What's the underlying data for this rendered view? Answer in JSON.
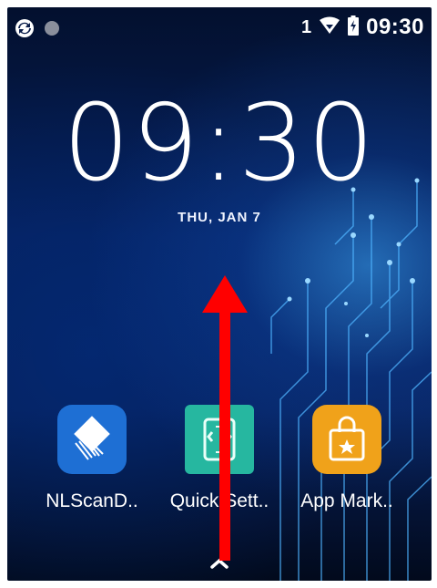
{
  "status_bar": {
    "left_icons": [
      "sync-icon",
      "notification-dot-icon"
    ],
    "sim_number": "1",
    "right_icons": [
      "wifi-icon",
      "battery-icon"
    ],
    "time": "09:30"
  },
  "lockscreen": {
    "clock": "09:30",
    "date": "THU, JAN 7"
  },
  "apps": [
    {
      "label": "NLScanD..",
      "icon": "nlscan-icon",
      "color": "#1e6fd4"
    },
    {
      "label": "Quick Sett..",
      "icon": "quick-settings-icon",
      "color": "#26b7a0"
    },
    {
      "label": "App Mark..",
      "icon": "app-market-icon",
      "color": "#f0a21a"
    }
  ],
  "nav": {
    "icon": "chevron-up-icon"
  },
  "overlay": {
    "icon": "swipe-up-arrow",
    "color": "#ff0000"
  }
}
